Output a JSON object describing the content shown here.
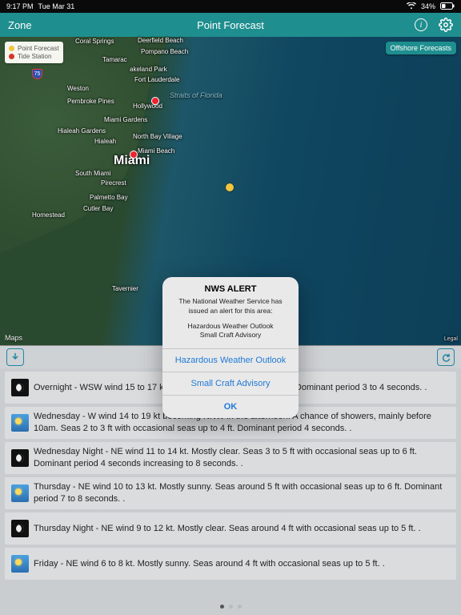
{
  "status": {
    "time": "9:17 PM",
    "date": "Tue Mar 31",
    "wifi_icon": "wifi-icon",
    "battery_pct": "34%",
    "battery_icon": "battery-icon"
  },
  "nav": {
    "left_label": "Zone",
    "title": "Point Forecast",
    "info_icon": "info-icon",
    "gear_icon": "gear-icon"
  },
  "map": {
    "legend": {
      "point_forecast": "Point Forecast",
      "tide_station": "Tide Station"
    },
    "offshore_button": "Offshore Forecasts",
    "attribution": "Maps",
    "labels": {
      "miami": "Miami",
      "straits": "Straits of Florida",
      "coral_springs": "Coral Springs",
      "deerfield_beach": "Deerfield Beach",
      "pompano_beach": "Pompano Beach",
      "tamarac": "Tamarac",
      "lakeland_park": "akeland Park",
      "fort_lauderdale": "Fort Lauderdale",
      "weston": "Weston",
      "hollywood": "Hollywood",
      "pembroke_pines": "Pembroke Pines",
      "miami_gardens": "Miami Gardens",
      "hialeah_gardens": "Hialeah Gardens",
      "north_bay_village": "North Bay Village",
      "hialeah": "Hialeah",
      "miami_beach": "Miami Beach",
      "south_miami": "South Miami",
      "pirecrest": "Pirecrest",
      "palmetto_bay": "Palmetto Bay",
      "cutler_bay": "Cutler Bay",
      "homestead": "Homestead",
      "tavernier": "Tavernier",
      "i75": "75",
      "legal": "Legal"
    }
  },
  "controls": {
    "down_icon": "download-icon",
    "grip": "——",
    "refresh_icon": "refresh-icon"
  },
  "forecast": [
    {
      "icon": "night",
      "text": "Overnight - WSW wind 15 to 17 kt. Partly cloudy. Seas around 2 ft. Dominant period 3 to 4 seconds. ."
    },
    {
      "icon": "day",
      "text": "Wednesday - W wind 14 to 19 kt becoming NNW in the afternoon. A chance of showers, mainly before 10am. Seas 2 to 3 ft with occasional seas up to 4 ft. Dominant period 4 seconds. ."
    },
    {
      "icon": "night",
      "text": "Wednesday Night - NE wind 11 to 14 kt. Mostly clear. Seas 3 to 5 ft with occasional seas up to 6 ft. Dominant period 4 seconds increasing to 8 seconds. ."
    },
    {
      "icon": "day",
      "text": "Thursday - NE wind 10 to 13 kt. Mostly sunny. Seas around 5 ft with occasional seas up to 6 ft. Dominant period 7 to 8 seconds. ."
    },
    {
      "icon": "night",
      "text": "Thursday Night - NE wind 9 to 12 kt. Mostly clear. Seas around 4 ft with occasional seas up to 5 ft. ."
    },
    {
      "icon": "day",
      "text": "Friday - NE wind 6 to 8 kt. Mostly sunny. Seas around 4 ft with occasional seas up to 5 ft. ."
    }
  ],
  "pager": {
    "index": 0,
    "count": 3
  },
  "alert": {
    "title": "NWS ALERT",
    "body": "The National Weather Service has issued an alert for this area:",
    "sub1": "Hazardous Weather Outlook",
    "sub2": "Small Craft Advisory",
    "button1": "Hazardous Weather Outlook",
    "button2": "Small Craft Advisory",
    "button_ok": "OK"
  }
}
